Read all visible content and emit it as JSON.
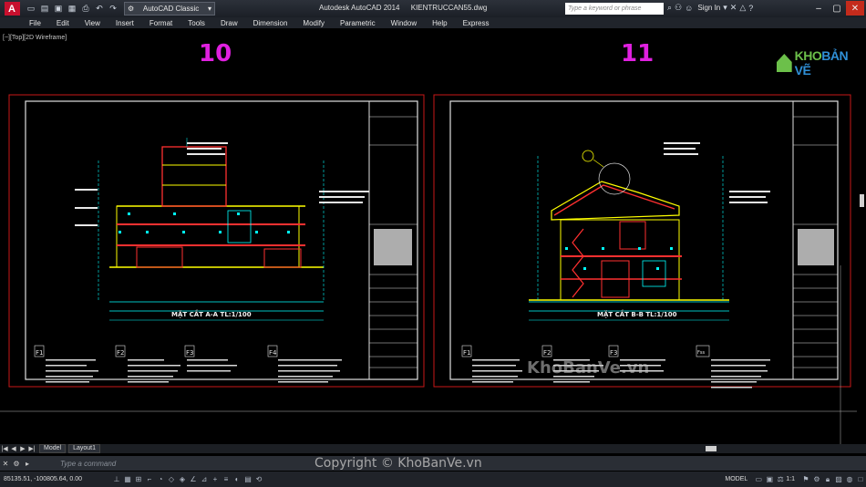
{
  "titlebar": {
    "app_name": "Autodesk AutoCAD 2014",
    "file_name": "KIENTRUCCAN55.dwg",
    "workspace": "AutoCAD Classic",
    "search_placeholder": "Type a keyword or phrase",
    "sign_in": "Sign In"
  },
  "menu": [
    "File",
    "Edit",
    "View",
    "Insert",
    "Format",
    "Tools",
    "Draw",
    "Dimension",
    "Modify",
    "Parametric",
    "Window",
    "Help",
    "Express"
  ],
  "viewport": {
    "label": "[−][Top][2D Wireframe]",
    "sheet_numbers": [
      "10",
      "11"
    ]
  },
  "sheets": [
    {
      "section_title": "MẶT CẮT A-A TL:1/100",
      "legend_codes": [
        "F1",
        "F2",
        "F3",
        "F4"
      ]
    },
    {
      "section_title": "MẶT CẮT B-B TL:1/100",
      "legend_codes": [
        "F1",
        "F2",
        "F3",
        "Fss"
      ]
    }
  ],
  "brand": {
    "part1": "KHO",
    "part2": "BẢN VẼ"
  },
  "watermarks": {
    "center": "KhoBanVe.vn",
    "copyright": "Copyright © KhoBanVe.vn"
  },
  "tabs": [
    "Model",
    "Layout1"
  ],
  "command_line": {
    "placeholder": "Type a command"
  },
  "status": {
    "coords": "85135.51, -100805.64, 0.00",
    "mode": "MODEL",
    "scale": "1:1"
  }
}
